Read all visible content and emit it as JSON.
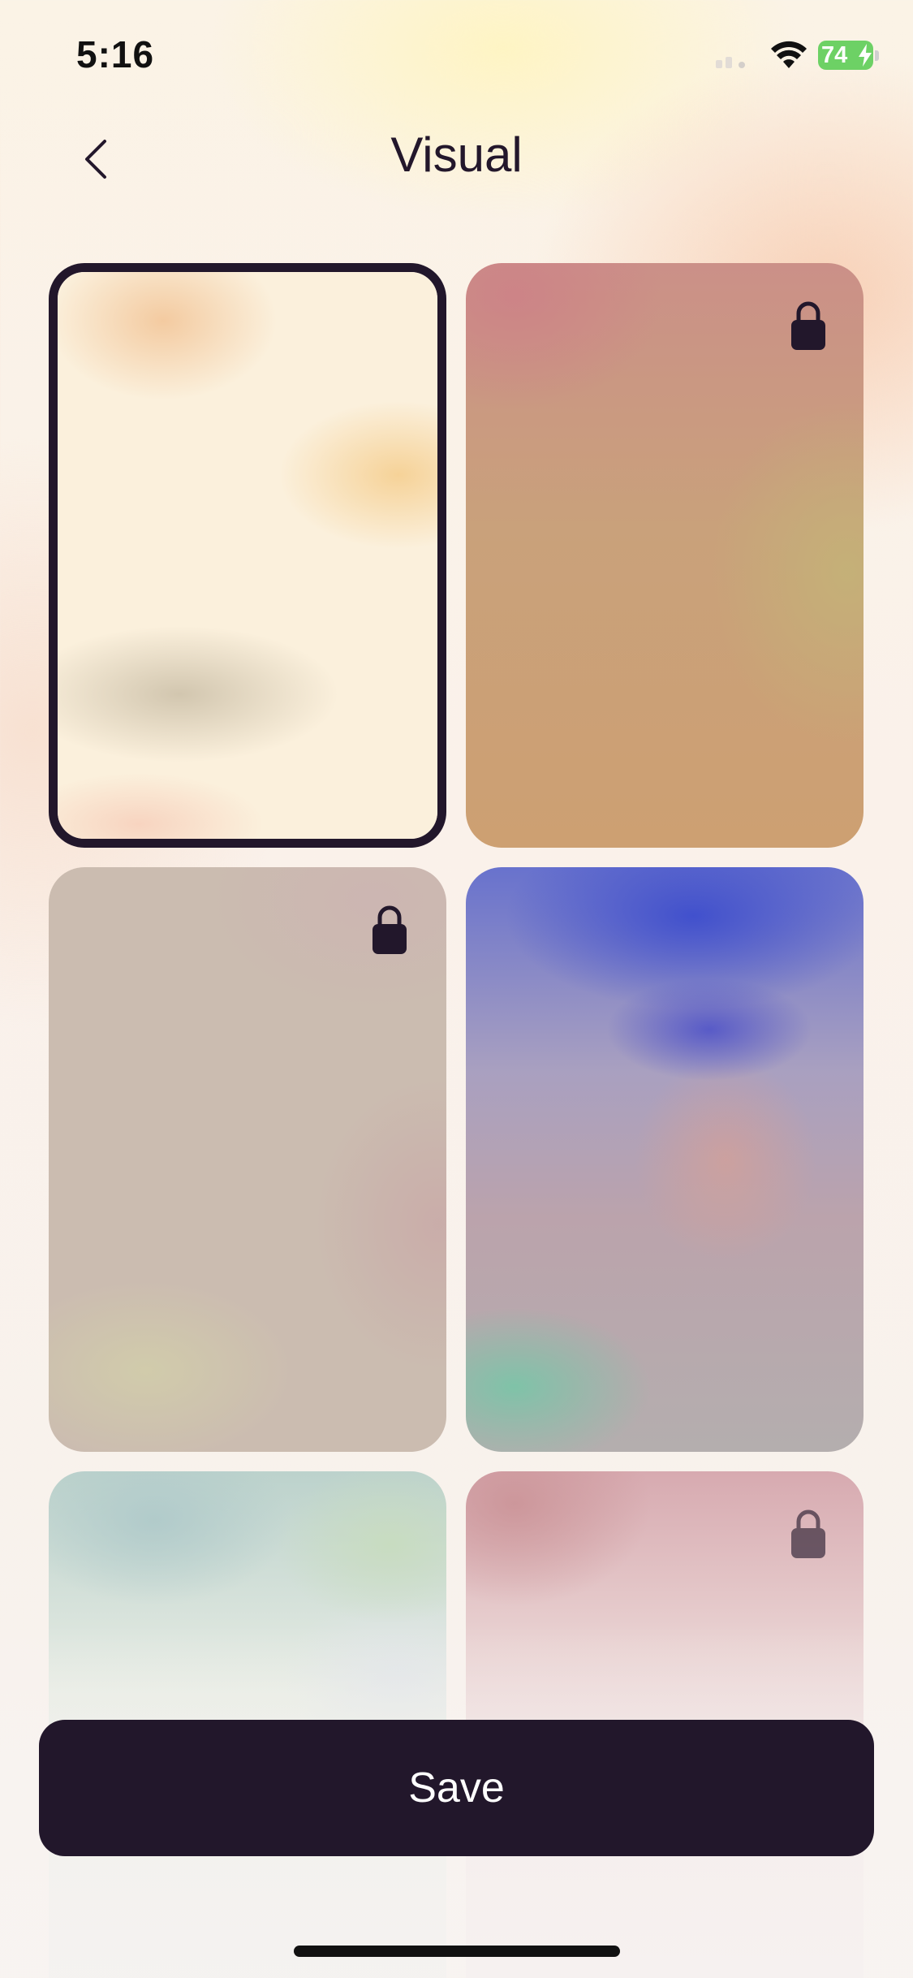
{
  "status_bar": {
    "time": "5:16",
    "battery_level": "74"
  },
  "header": {
    "title": "Visual",
    "back_icon": "chevron-left-icon"
  },
  "visuals": [
    {
      "selected": true,
      "locked": false,
      "colors": [
        "#fbf0dc",
        "#f2c496",
        "#c4b8a0"
      ]
    },
    {
      "selected": false,
      "locked": true,
      "colors": [
        "#cb9088",
        "#cda072",
        "#c4b278"
      ]
    },
    {
      "selected": false,
      "locked": true,
      "colors": [
        "#cbbcb0",
        "#c9aaa8",
        "#d2ceaa"
      ]
    },
    {
      "selected": false,
      "locked": false,
      "colors": [
        "#3e4ecd",
        "#bba3ac",
        "#7cc4a8"
      ]
    },
    {
      "selected": false,
      "locked": false,
      "colors": [
        "#bcd2cc",
        "#e7ece4",
        "#c8dcbe"
      ]
    },
    {
      "selected": false,
      "locked": true,
      "colors": [
        "#d7aab0",
        "#e9d2d2",
        "#f3ecec"
      ]
    }
  ],
  "save_button": {
    "label": "Save"
  },
  "colors": {
    "accent": "#22172b",
    "battery": "#6dd165"
  }
}
